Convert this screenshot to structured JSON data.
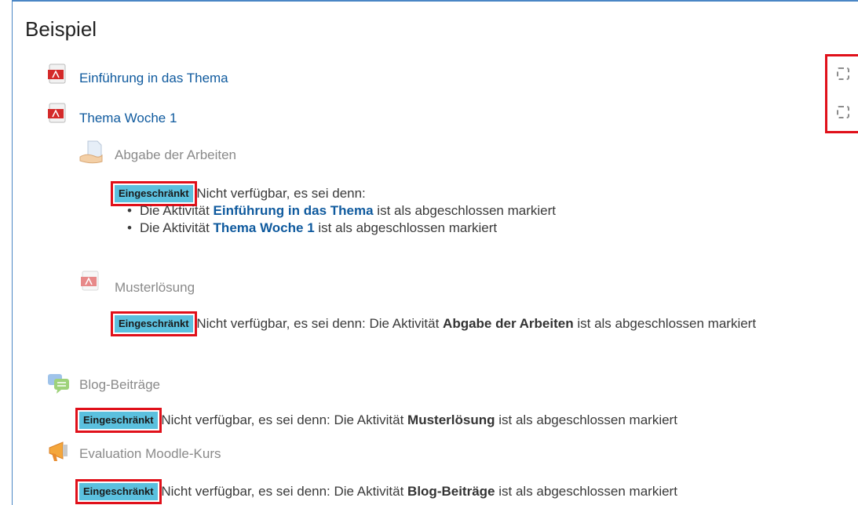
{
  "section": {
    "title": "Beispiel"
  },
  "activities": [
    {
      "name": "Einführung in das Thema",
      "icon": "pdf-icon"
    },
    {
      "name": "Thema Woche 1",
      "icon": "pdf-icon"
    },
    {
      "name": "Abgabe der Arbeiten",
      "icon": "assignment-icon"
    },
    {
      "name": "Musterlösung",
      "icon": "pdf-icon"
    },
    {
      "name": "Blog-Beiträge",
      "icon": "forum-icon"
    },
    {
      "name": "Evaluation Moodle-Kurs",
      "icon": "feedback-icon"
    }
  ],
  "restrictions": {
    "badge": "Eingeschränkt",
    "abgabe": {
      "prefix": "Nicht verfügbar, es sei denn:",
      "items": [
        {
          "pre": "Die Aktivität ",
          "link": "Einführung in das Thema",
          "post": " ist als abgeschlossen markiert"
        },
        {
          "pre": "Die Aktivität ",
          "link": "Thema Woche 1",
          "post": " ist als abgeschlossen markiert"
        }
      ]
    },
    "muster": {
      "pre": "Nicht verfügbar, es sei denn: Die Aktivität ",
      "bold": "Abgabe der Arbeiten",
      "post": " ist als abgeschlossen markiert"
    },
    "blog": {
      "pre": "Nicht verfügbar, es sei denn: Die Aktivität ",
      "bold": "Musterlösung",
      "post": " ist als abgeschlossen markiert"
    },
    "evaluation": {
      "pre": "Nicht verfügbar, es sei denn: Die Aktivität ",
      "bold": "Blog-Beiträge",
      "post": " ist als abgeschlossen markiert"
    }
  },
  "colors": {
    "badge": "#5bc0de",
    "highlight": "#e0101a",
    "link": "#0f5a9e"
  }
}
